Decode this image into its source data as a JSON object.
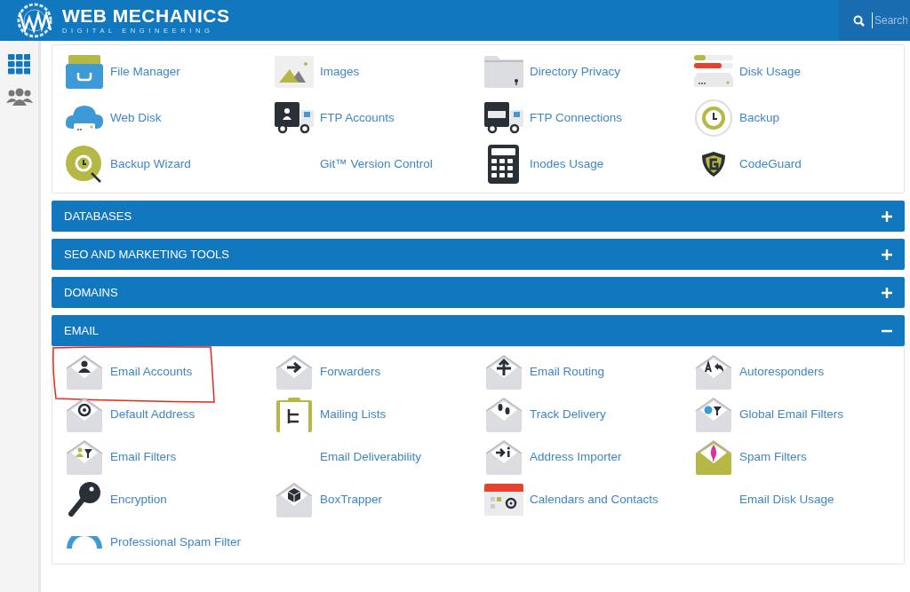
{
  "header": {
    "brand": "WEB MECHANICS",
    "tagline": "DIGITAL ENGINEERING",
    "search": {
      "placeholder": "Search"
    }
  },
  "sidebar": {
    "items": [
      {
        "kind": "grid",
        "selected": true
      },
      {
        "kind": "users",
        "selected": false
      }
    ]
  },
  "sections": [
    {
      "items": [
        {
          "label": "File Manager",
          "kind": "drawer"
        },
        {
          "label": "Images",
          "kind": "landscape"
        },
        {
          "label": "Directory Privacy",
          "kind": "folder"
        },
        {
          "label": "Disk Usage",
          "kind": "meter"
        },
        {
          "label": "Web Disk",
          "kind": "cloud"
        },
        {
          "label": "FTP Accounts",
          "kind": "truck"
        },
        {
          "label": "FTP Connections",
          "kind": "ftptruck"
        },
        {
          "label": "Backup",
          "kind": "backup"
        },
        {
          "label": "Backup Wizard",
          "kind": "wizard"
        },
        {
          "label": "Git™ Version Control",
          "kind": "none"
        },
        {
          "label": "Inodes Usage",
          "kind": "calculator"
        },
        {
          "label": "CodeGuard",
          "kind": "shield"
        }
      ]
    },
    {
      "title": "DATABASES",
      "expanded": false
    },
    {
      "title": "SEO AND MARKETING TOOLS",
      "expanded": false
    },
    {
      "title": "DOMAINS",
      "expanded": false
    },
    {
      "title": "EMAIL",
      "expanded": true,
      "items": [
        {
          "label": "Email Accounts",
          "kind": "person",
          "highlighted": true
        },
        {
          "label": "Forwarders",
          "kind": "arrow"
        },
        {
          "label": "Email Routing",
          "kind": "fork"
        },
        {
          "label": "Autoresponders",
          "kind": "reply"
        },
        {
          "label": "Default Address",
          "kind": "at"
        },
        {
          "label": "Mailing Lists",
          "kind": "list"
        },
        {
          "label": "Track Delivery",
          "kind": "steps"
        },
        {
          "label": "Global Email Filters",
          "kind": "globefilter"
        },
        {
          "label": "Email Filters",
          "kind": "personfilter"
        },
        {
          "label": "Email Deliverability",
          "kind": "none"
        },
        {
          "label": "Address Importer",
          "kind": "import"
        },
        {
          "label": "Spam Filters",
          "kind": "spam"
        },
        {
          "label": "Encryption",
          "kind": "key"
        },
        {
          "label": "BoxTrapper",
          "kind": "box"
        },
        {
          "label": "Calendars and Contacts",
          "kind": "calendar"
        },
        {
          "label": "Email Disk Usage",
          "kind": "none"
        },
        {
          "label": "Professional Spam Filter",
          "kind": "ring"
        }
      ]
    }
  ]
}
